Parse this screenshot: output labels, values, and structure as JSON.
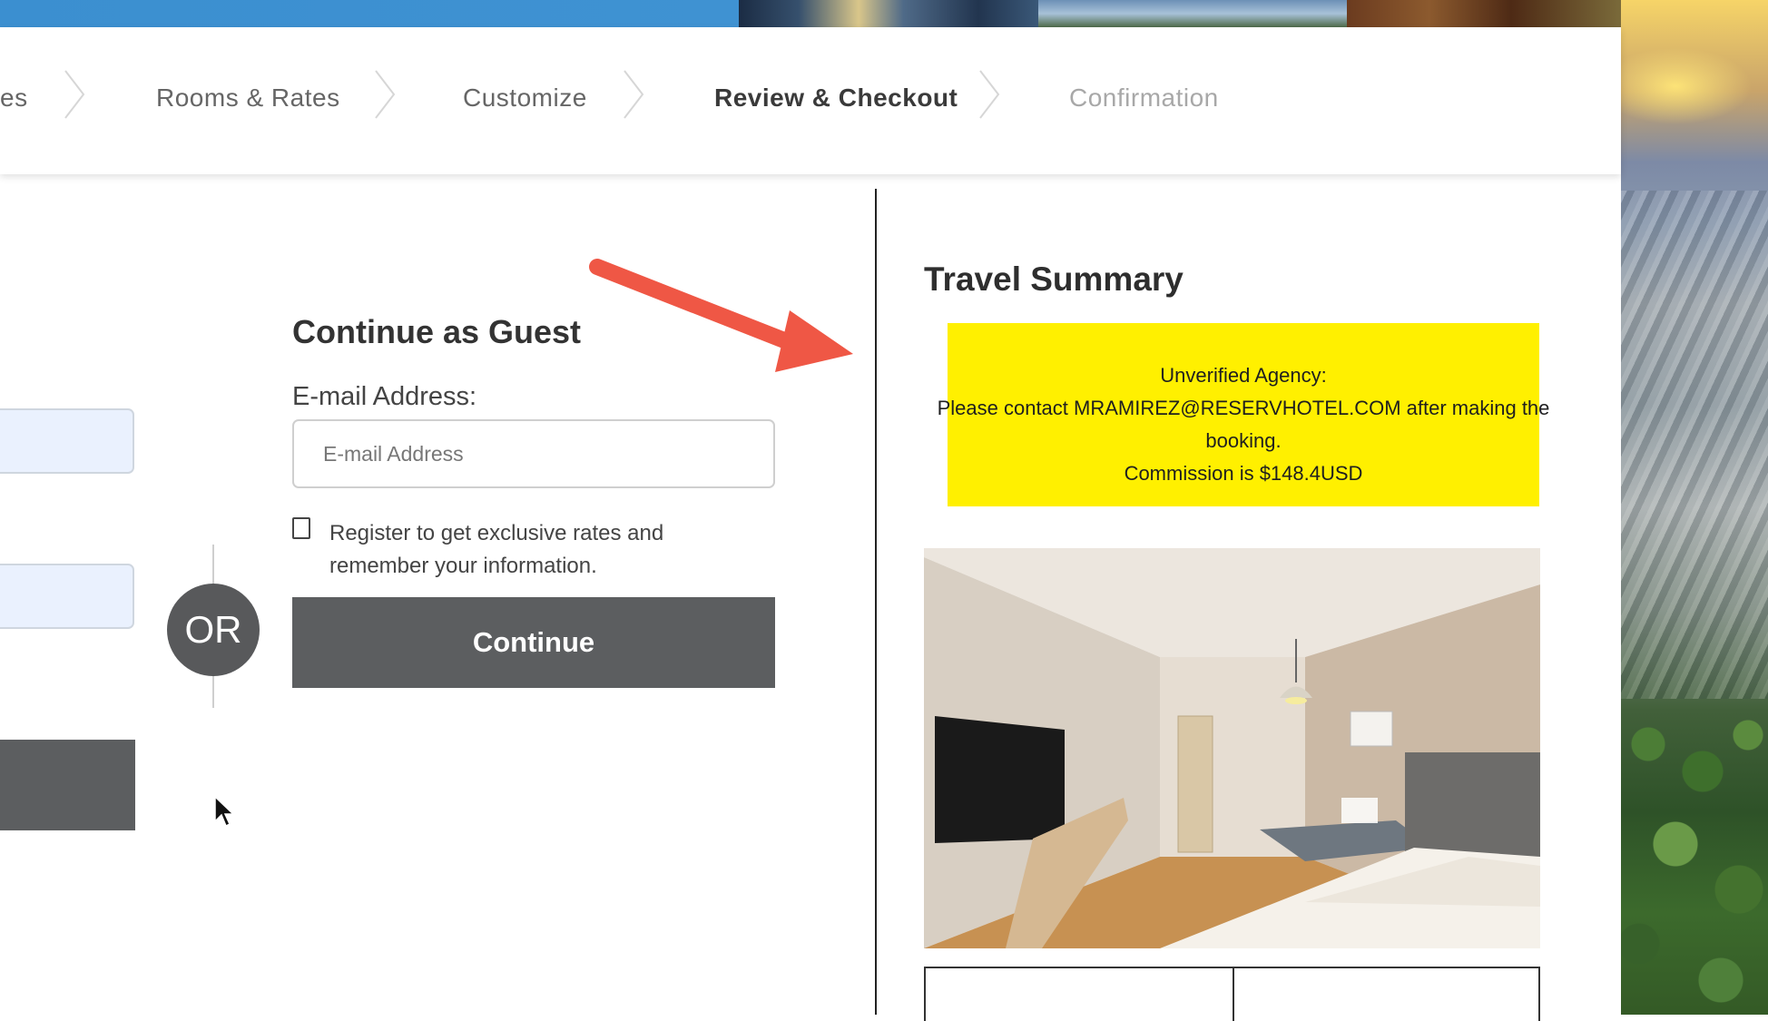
{
  "steps": {
    "items": [
      {
        "label": "es",
        "state": "done"
      },
      {
        "label": "Rooms & Rates",
        "state": "done"
      },
      {
        "label": "Customize",
        "state": "done"
      },
      {
        "label": "Review & Checkout",
        "state": "active"
      },
      {
        "label": "Confirmation",
        "state": "pending"
      }
    ]
  },
  "divider": {
    "or_label": "OR"
  },
  "guest": {
    "title": "Continue as Guest",
    "email_label": "E-mail Address:",
    "email_placeholder": "E-mail Address",
    "email_value": "",
    "register_label": "Register to get exclusive rates and remember your information.",
    "register_checked": false,
    "continue_label": "Continue"
  },
  "summary": {
    "title": "Travel Summary",
    "notice": {
      "line1": "Unverified Agency:",
      "line2": "Please contact MRAMIREZ@RESERVHOTEL.COM after making the booking.",
      "line3": "Commission is $148.4USD",
      "background": "#fff000"
    }
  },
  "colors": {
    "accent_banner": "#3b8fd0",
    "button_dark": "#5c5e60",
    "input_prefilled": "#eaf1fe",
    "annotation_arrow": "#ef5745"
  },
  "icons": {
    "step_separator": "chevron-right-icon",
    "annotation": "arrow-annotation-icon",
    "pointer": "mouse-cursor-icon"
  }
}
